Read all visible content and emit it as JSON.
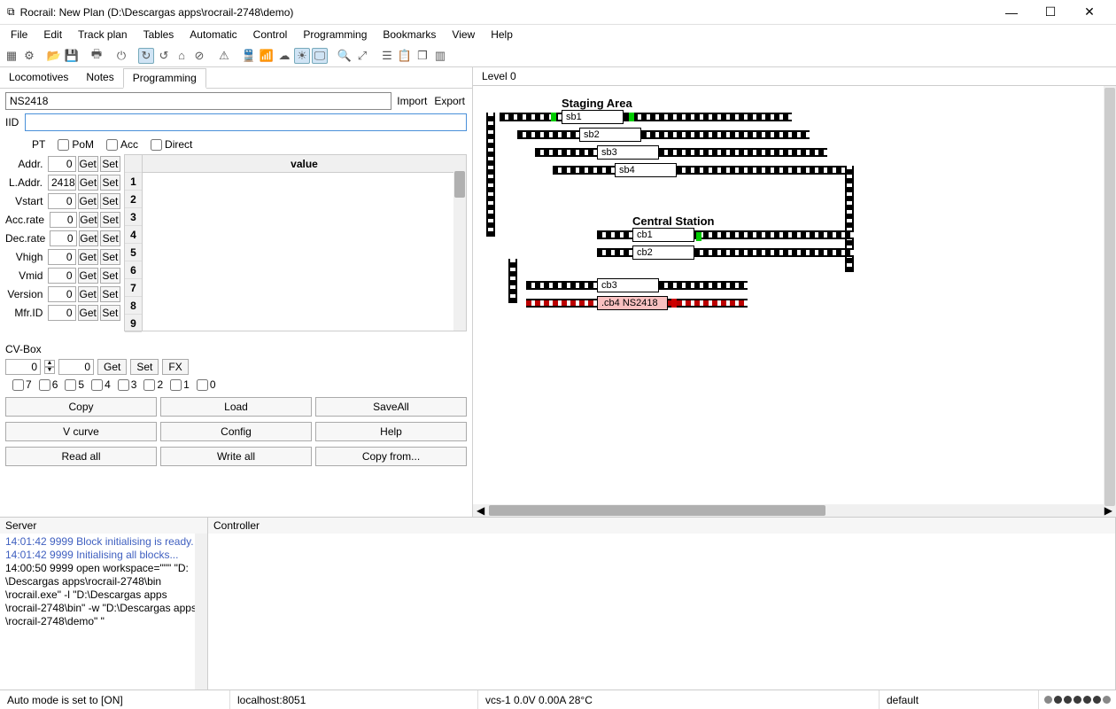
{
  "window": {
    "title": "Rocrail: New Plan (D:\\Descargas apps\\rocrail-2748\\demo)"
  },
  "menu": [
    "File",
    "Edit",
    "Track plan",
    "Tables",
    "Automatic",
    "Control",
    "Programming",
    "Bookmarks",
    "View",
    "Help"
  ],
  "left_tabs": [
    "Locomotives",
    "Notes",
    "Programming"
  ],
  "left_active_tab": 2,
  "loco_select": "NS2418",
  "import_label": "Import",
  "export_label": "Export",
  "iid_label": "IID",
  "iid_value": "",
  "radios": [
    "PT",
    "PoM",
    "Acc",
    "Direct"
  ],
  "cv_rows": [
    {
      "label": "Addr.",
      "value": "0"
    },
    {
      "label": "L.Addr.",
      "value": "2418"
    },
    {
      "label": "Vstart",
      "value": "0"
    },
    {
      "label": "Acc.rate",
      "value": "0"
    },
    {
      "label": "Dec.rate",
      "value": "0"
    },
    {
      "label": "Vhigh",
      "value": "0"
    },
    {
      "label": "Vmid",
      "value": "0"
    },
    {
      "label": "Version",
      "value": "0"
    },
    {
      "label": "Mfr.ID",
      "value": "0"
    }
  ],
  "get_label": "Get",
  "set_label": "Set",
  "value_header": "value",
  "row_nums": [
    "1",
    "2",
    "3",
    "4",
    "5",
    "6",
    "7",
    "8",
    "9"
  ],
  "cvbox_title": "CV-Box",
  "cvbox_a": "0",
  "cvbox_b": "0",
  "fx_label": "FX",
  "chk_nums": [
    "7",
    "6",
    "5",
    "4",
    "3",
    "2",
    "1",
    "0"
  ],
  "btns1": [
    "Copy",
    "Load",
    "SaveAll"
  ],
  "btns2": [
    "V curve",
    "Config",
    "Help"
  ],
  "btns3": [
    "Read all",
    "Write all",
    "Copy from..."
  ],
  "level_tab": "Level 0",
  "plan": {
    "areaA": "Staging Area",
    "areaB": "Central Station",
    "sb1": "sb1",
    "sb2": "sb2",
    "sb3": "sb3",
    "sb4": "sb4",
    "cb1": "cb1",
    "cb2": "cb2",
    "cb3": "cb3",
    "cb4": ".cb4 NS2418"
  },
  "bottom": {
    "server_label": "Server",
    "controller_label": "Controller",
    "log": [
      {
        "cls": "log-blue",
        "text": "14:01:42 9999 Block initialising is ready."
      },
      {
        "cls": "log-blue",
        "text": "14:01:42 9999 Initialising all blocks..."
      },
      {
        "cls": "",
        "text": "14:00:50 9999 open workspace=\"\"\" \"D:"
      },
      {
        "cls": "",
        "text": "\\Descargas apps\\rocrail-2748\\bin"
      },
      {
        "cls": "",
        "text": "\\rocrail.exe\" -l \"D:\\Descargas apps"
      },
      {
        "cls": "",
        "text": "\\rocrail-2748\\bin\" -w \"D:\\Descargas apps"
      },
      {
        "cls": "",
        "text": "\\rocrail-2748\\demo\" \""
      }
    ]
  },
  "status": {
    "mode": "Auto mode is set to [ON]",
    "host": "localhost:8051",
    "power": "vcs-1 0.0V 0.00A 28°C",
    "plan": "default"
  }
}
